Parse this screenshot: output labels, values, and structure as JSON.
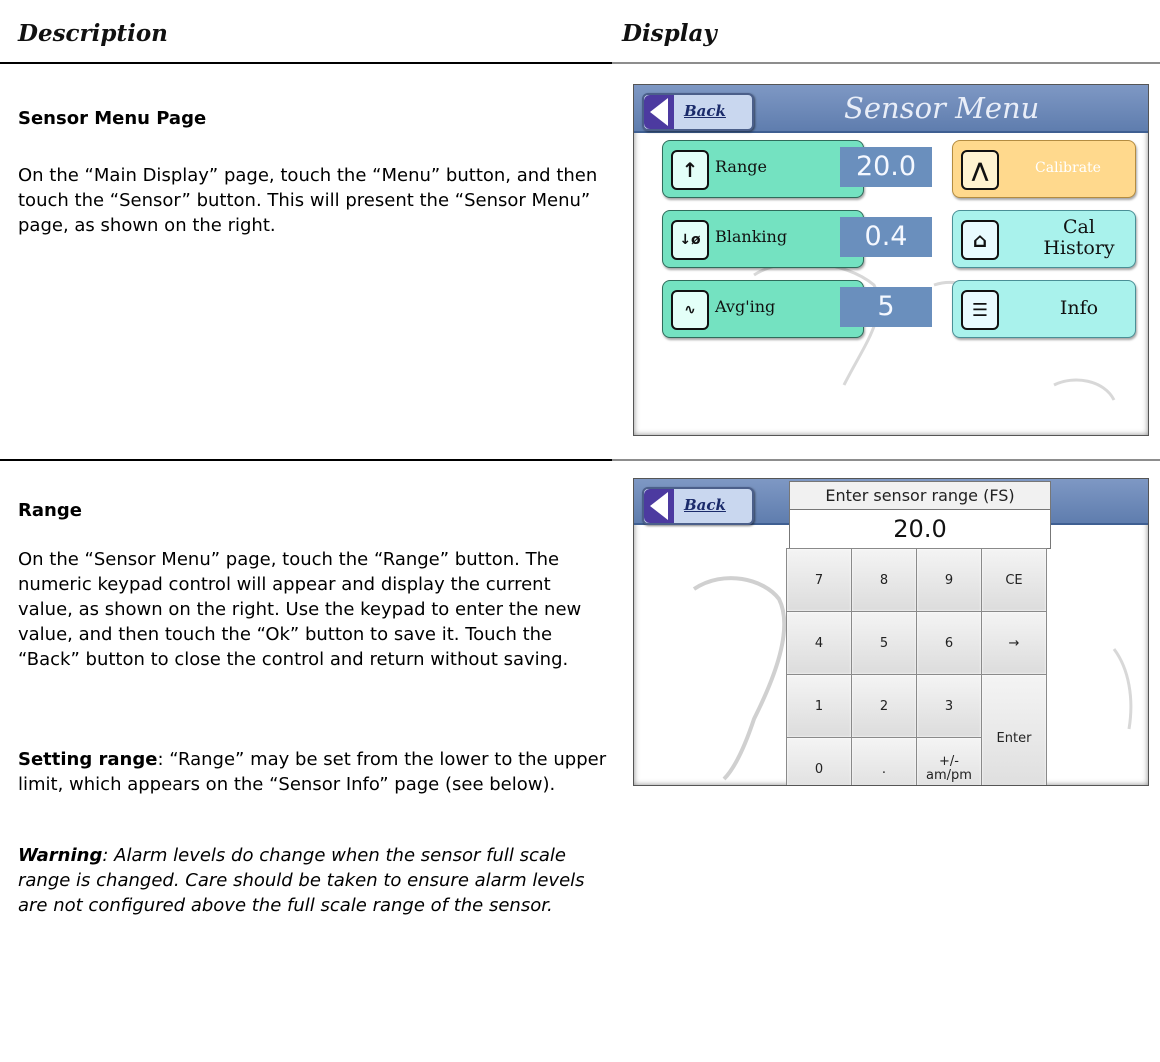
{
  "headers": {
    "description": "Description",
    "display": "Display"
  },
  "section1": {
    "title": "Sensor Menu Page",
    "paragraph": "On the “Main Display” page, touch the “Menu” button, and then touch the “Sensor” button.  This will present the “Sensor Menu” page, as shown on the right."
  },
  "section2": {
    "title": "Range",
    "paragraph": "On the “Sensor Menu” page, touch the “Range” button.  The numeric keypad control will appear and display the current value, as shown on the right.  Use the keypad to enter the new value, and then touch the “Ok” button to save it.  Touch the “Back” button to close the control and return without saving.",
    "setting_label": "Setting range",
    "setting_text": ":  “Range” may be set from the lower to the upper limit, which appears on the “Sensor Info” page (see below).",
    "warning_label": "Warning",
    "warning_text": ": Alarm levels do change when the sensor full scale range is changed.  Care should be taken to ensure alarm levels are not configured above the full scale range of the sensor."
  },
  "sensor_menu": {
    "back": "Back",
    "title": "Sensor Menu",
    "range_label": "Range",
    "range_value": "20.0",
    "calibrate_label": "Calibrate",
    "blanking_label": "Blanking",
    "blanking_value": "0.4",
    "cal_history_line1": "Cal",
    "cal_history_line2": "History",
    "averaging_label": "Avg'ing",
    "averaging_value": "5",
    "info_label": "Info"
  },
  "keypad": {
    "back": "Back",
    "prompt": "Enter sensor range (FS)",
    "value": "20.0",
    "keys": [
      "7",
      "8",
      "9",
      "CE",
      "4",
      "5",
      "6",
      "→",
      "1",
      "2",
      "3",
      "Enter",
      "0",
      ".",
      "+/-",
      "am/pm"
    ]
  }
}
